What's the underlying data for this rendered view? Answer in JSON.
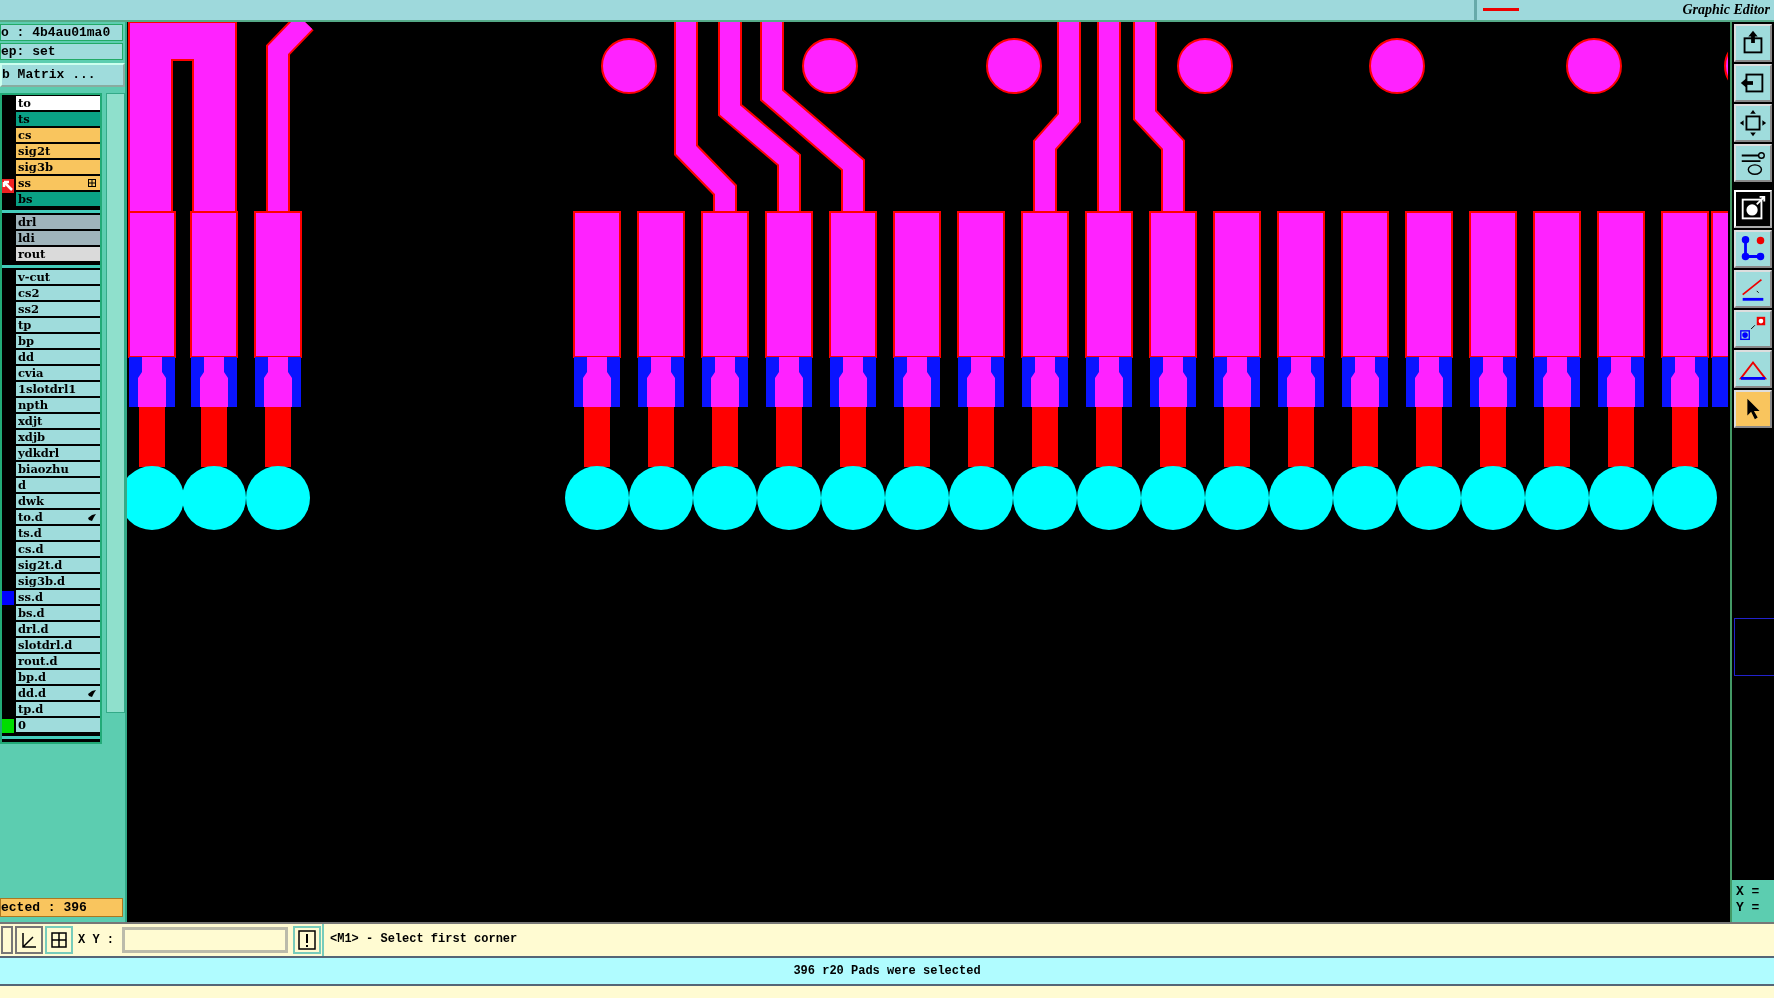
{
  "title_area": {
    "subtitle": "Graphic Editor"
  },
  "header": {
    "job": "o : 4b4au01ma0",
    "step": "ep: set",
    "matrix_button": "b Matrix ..."
  },
  "layer_groups": [
    {
      "layers": [
        {
          "name": "to",
          "color": "#ffffff"
        },
        {
          "name": "ts",
          "color": "#0aa085"
        },
        {
          "name": "cs",
          "color": "#f9c55e"
        },
        {
          "name": "sig2t",
          "color": "#f9c55e"
        },
        {
          "name": "sig3b",
          "color": "#f9c55e"
        },
        {
          "name": "ss",
          "color": "#f9c55e",
          "marker": {
            "kind": "arrow"
          },
          "tag": {
            "kind": "grid"
          }
        },
        {
          "name": "bs",
          "color": "#0aa085"
        }
      ]
    },
    {
      "layers": [
        {
          "name": "drl",
          "color": "#9fb4bb"
        },
        {
          "name": "ldi",
          "color": "#9fb4bb"
        },
        {
          "name": "rout",
          "color": "#dadada"
        }
      ]
    },
    {
      "layers": [
        {
          "name": "v-cut",
          "color": "#9fdcdc"
        },
        {
          "name": "cs2",
          "color": "#9fdcdc"
        },
        {
          "name": "ss2",
          "color": "#9fdcdc"
        },
        {
          "name": "tp",
          "color": "#9fdcdc"
        },
        {
          "name": "bp",
          "color": "#9fdcdc"
        },
        {
          "name": "dd",
          "color": "#9fdcdc"
        },
        {
          "name": "cvia",
          "color": "#9fdcdc"
        },
        {
          "name": "1slotdrl1",
          "color": "#9fdcdc"
        },
        {
          "name": "npth",
          "color": "#9fdcdc"
        },
        {
          "name": "xdjt",
          "color": "#9fdcdc"
        },
        {
          "name": "xdjb",
          "color": "#9fdcdc"
        },
        {
          "name": "ydkdrl",
          "color": "#9fdcdc"
        },
        {
          "name": "biaozhu",
          "color": "#9fdcdc"
        },
        {
          "name": "d",
          "color": "#9fdcdc"
        },
        {
          "name": "dwk",
          "color": "#9fdcdc"
        },
        {
          "name": "to.d",
          "color": "#9fdcdc",
          "tag": {
            "kind": "hand"
          }
        },
        {
          "name": "ts.d",
          "color": "#9fdcdc"
        },
        {
          "name": "cs.d",
          "color": "#9fdcdc"
        },
        {
          "name": "sig2t.d",
          "color": "#9fdcdc"
        },
        {
          "name": "sig3b.d",
          "color": "#9fdcdc"
        },
        {
          "name": "ss.d",
          "color": "#9fdcdc",
          "marker": {
            "kind": "square",
            "color": "#0000ff"
          }
        },
        {
          "name": "bs.d",
          "color": "#9fdcdc"
        },
        {
          "name": "drl.d",
          "color": "#9fdcdc"
        },
        {
          "name": "slotdrl.d",
          "color": "#9fdcdc"
        },
        {
          "name": "rout.d",
          "color": "#9fdcdc"
        },
        {
          "name": "bp.d",
          "color": "#9fdcdc"
        },
        {
          "name": "dd.d",
          "color": "#9fdcdc",
          "tag": {
            "kind": "hand"
          }
        },
        {
          "name": "tp.d",
          "color": "#9fdcdc"
        },
        {
          "name": "0",
          "color": "#9fdcdc",
          "marker": {
            "kind": "square",
            "color": "#00dd00"
          }
        }
      ]
    }
  ],
  "selected_count": "ected : 396",
  "toolbar": [
    {
      "kind": "import",
      "active": false
    },
    {
      "kind": "export",
      "active": false
    },
    {
      "kind": "fit",
      "active": false
    },
    {
      "kind": "tools",
      "active": false
    },
    {
      "kind": "pad",
      "active": true
    },
    {
      "kind": "net",
      "active": false
    },
    {
      "kind": "line",
      "active": false
    },
    {
      "kind": "move",
      "active": false
    },
    {
      "kind": "polygon",
      "active": false
    },
    {
      "kind": "pointer",
      "selected": true
    }
  ],
  "coordinates": {
    "x_label": "X =",
    "y_label": "Y ="
  },
  "command_bar": {
    "xy_label": "X Y :",
    "prompt": "<M1> - Select first corner"
  },
  "status_bar": "396 r20 Pads were selected"
}
